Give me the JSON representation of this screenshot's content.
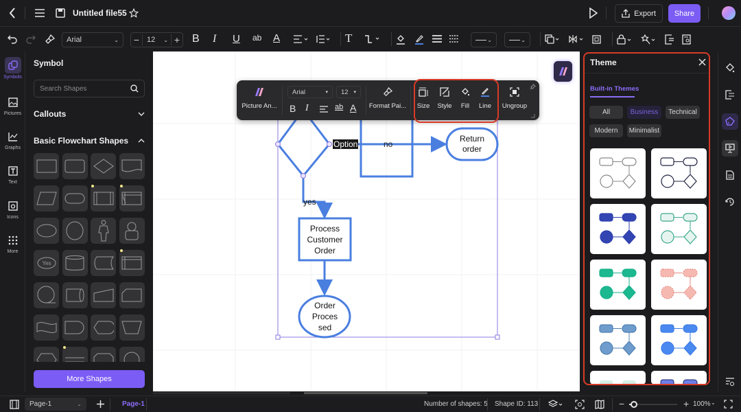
{
  "header": {
    "title": "Untitled file55",
    "export_label": "Export",
    "share_label": "Share"
  },
  "toolbar": {
    "font": "Arial",
    "font_size": "12",
    "bold": "B",
    "italic": "I",
    "underline": "U",
    "strike_ab": "ab",
    "text_color": "A",
    "text_tool": "T"
  },
  "left_rail": [
    {
      "label": "Symbols",
      "icon": "symbols-icon",
      "active": true
    },
    {
      "label": "Pictures",
      "icon": "pictures-icon"
    },
    {
      "label": "Graphs",
      "icon": "graphs-icon"
    },
    {
      "label": "Text",
      "icon": "text-icon"
    },
    {
      "label": "Icons",
      "icon": "icons-icon"
    },
    {
      "label": "More",
      "icon": "more-grid-icon"
    }
  ],
  "symbol_panel": {
    "title": "Symbol",
    "search_placeholder": "Search Shapes",
    "sections": [
      {
        "label": "Callouts",
        "expanded": false
      },
      {
        "label": "Basic Flowchart Shapes",
        "expanded": true
      }
    ],
    "more_shapes_label": "More Shapes",
    "shapes": [
      "rectangle",
      "rounded-rectangle",
      "diamond",
      "document",
      "parallelogram",
      "terminator",
      "predefined-process",
      "internal-storage",
      "ellipse",
      "circle",
      "actor",
      "user",
      "yes-decision",
      "database",
      "stored-data",
      "card",
      "sequential-data",
      "direct-data",
      "manual-input",
      "card-cut",
      "tape",
      "delay",
      "display",
      "manual-operation",
      "preparation",
      "annotation",
      "loop-limit",
      "connector"
    ]
  },
  "floating_toolbar": {
    "picture_label": "Picture An...",
    "font": "Arial",
    "font_size": "12",
    "format_painter_label": "Format Pai...",
    "size_label": "Size",
    "style_label": "Style",
    "fill_label": "Fill",
    "line_label": "Line",
    "ungroup_label": "Ungroup"
  },
  "diagram": {
    "option_label": "Option",
    "no_label": "no",
    "yes_label": "yes",
    "return_order": [
      "Return",
      "order"
    ],
    "process_customer_order": [
      "Process",
      "Customer",
      "Order"
    ],
    "order_processed": [
      "Order",
      "Proces",
      "sed"
    ]
  },
  "theme_panel": {
    "title": "Theme",
    "tab_label": "Built-in Themes",
    "filters": [
      {
        "label": "All",
        "active": false
      },
      {
        "label": "Business",
        "active": true
      },
      {
        "label": "Technical",
        "active": false
      },
      {
        "label": "Modern",
        "active": false
      },
      {
        "label": "Minimalist",
        "active": false
      }
    ],
    "themes": [
      {
        "name": "outline-gray",
        "stroke": "#888888",
        "fill": "#ffffff"
      },
      {
        "name": "outline-dark",
        "stroke": "#1f2340",
        "fill": "#ffffff"
      },
      {
        "name": "solid-navy",
        "stroke": "#2d3fae",
        "fill": "#3344b3"
      },
      {
        "name": "mint-outline",
        "stroke": "#3aa88a",
        "fill": "#e6f4f0"
      },
      {
        "name": "solid-teal",
        "stroke": "#17b08a",
        "fill": "#1cb890"
      },
      {
        "name": "dotted-salmon",
        "stroke": "#e58a80",
        "fill": "#f6b9b1"
      },
      {
        "name": "steel-blue",
        "stroke": "#4f7fb0",
        "fill": "#6e9ccc"
      },
      {
        "name": "bright-blue",
        "stroke": "#3b7be6",
        "fill": "#4a89f0"
      }
    ]
  },
  "status": {
    "page_select": "Page-1",
    "page_tab": "Page-1",
    "shape_count": "Number of shapes: 5",
    "shape_id": "Shape ID: 113",
    "zoom": "100%",
    "zoom_fraction": 0.1
  },
  "colors": {
    "accent": "#7b5cf5",
    "highlight_border": "#d93a26",
    "diagram_stroke": "#4a7fe0"
  }
}
